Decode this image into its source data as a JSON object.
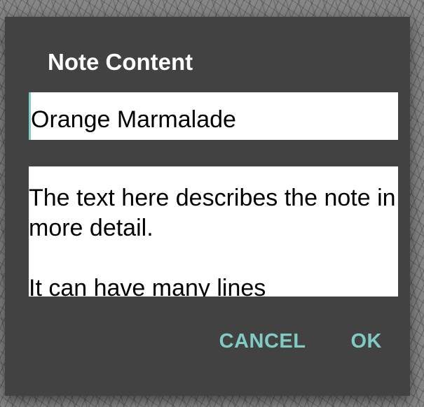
{
  "dialog": {
    "title": "Note Content",
    "title_field_value": "Orange Marmalade",
    "body_field_value": "The text here describes the note in more detail.\n\nIt can have many lines",
    "cancel_label": "CANCEL",
    "ok_label": "OK"
  },
  "colors": {
    "dialog_background": "#424242",
    "accent": "#80cbc4",
    "field_background": "#ffffff",
    "title_text": "#ffffff"
  }
}
